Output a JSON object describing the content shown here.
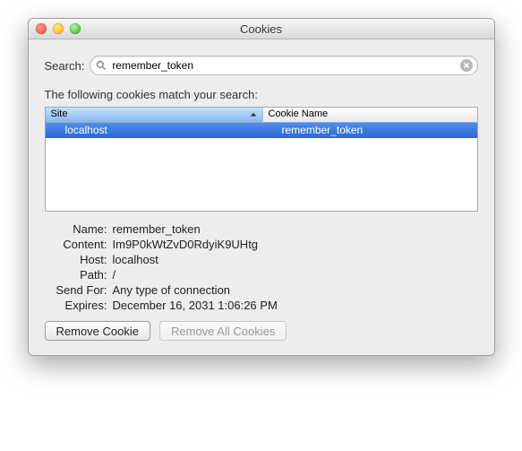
{
  "window": {
    "title": "Cookies"
  },
  "search": {
    "label": "Search:",
    "value": "remember_token"
  },
  "match_text": "The following cookies match your search:",
  "table": {
    "columns": {
      "site": "Site",
      "cookie_name": "Cookie Name"
    },
    "rows": [
      {
        "site": "localhost",
        "cookie_name": "remember_token"
      }
    ]
  },
  "details": {
    "labels": {
      "name": "Name:",
      "content": "Content:",
      "host": "Host:",
      "path": "Path:",
      "send_for": "Send For:",
      "expires": "Expires:"
    },
    "values": {
      "name": "remember_token",
      "content": "Im9P0kWtZvD0RdyiK9UHtg",
      "host": "localhost",
      "path": "/",
      "send_for": "Any type of connection",
      "expires": "December 16, 2031 1:06:26 PM"
    }
  },
  "buttons": {
    "remove": "Remove Cookie",
    "remove_all": "Remove All Cookies"
  }
}
